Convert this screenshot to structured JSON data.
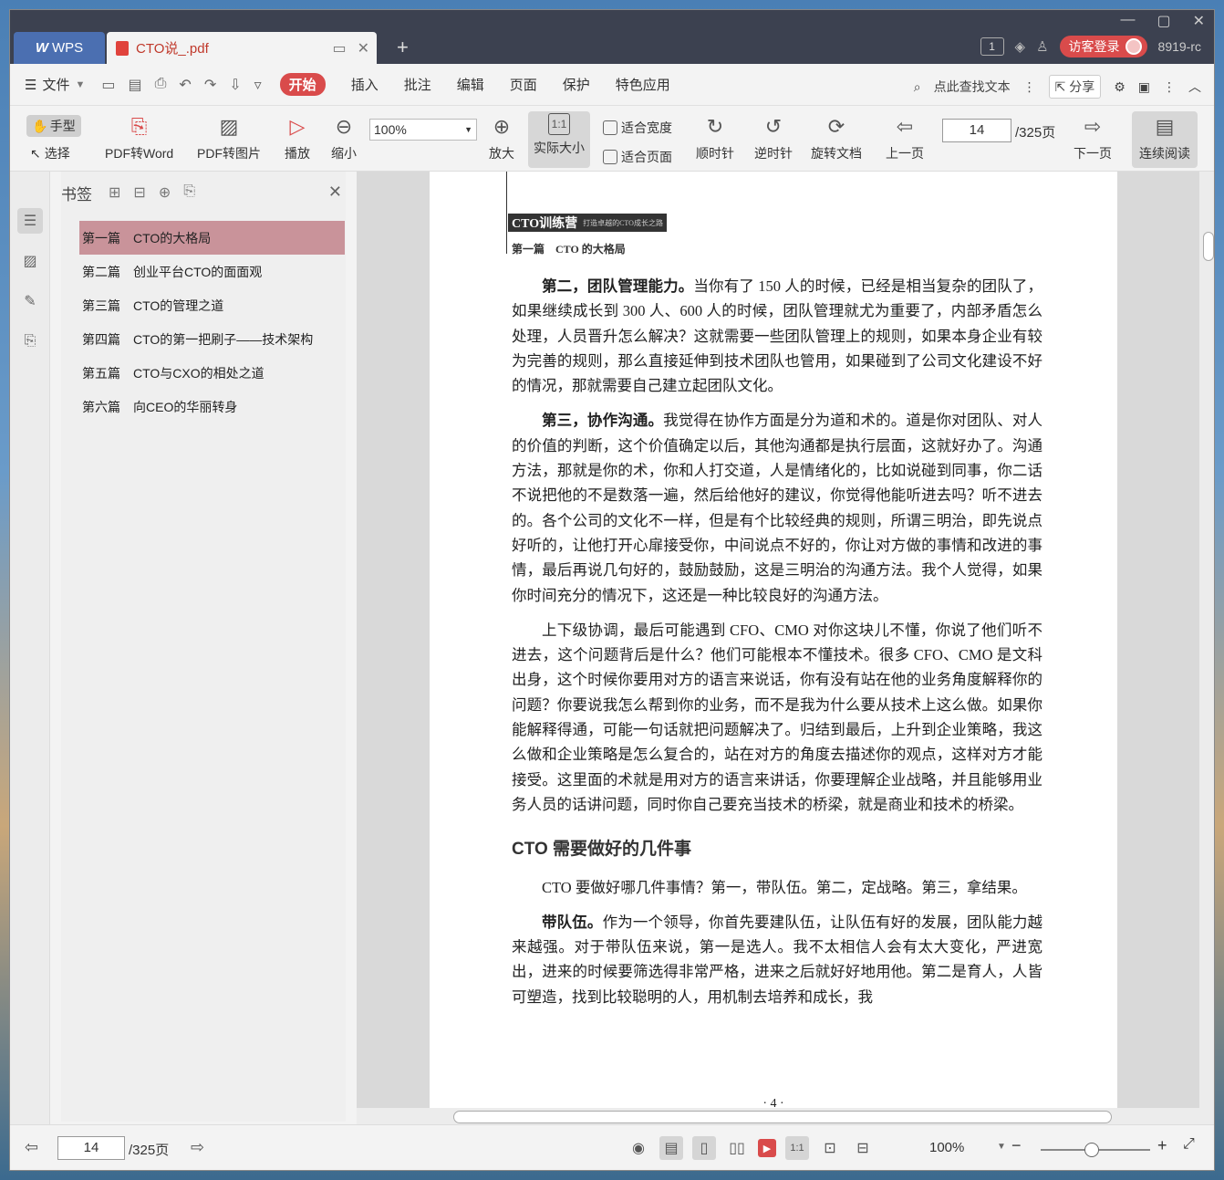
{
  "titlebar": {
    "app_tab": "WPS",
    "doc_tab": "CTO说_.pdf",
    "page_badge": "1",
    "visitor_login": "访客登录",
    "version": "8919-rc"
  },
  "menubar": {
    "file": "文件",
    "items": [
      "开始",
      "插入",
      "批注",
      "编辑",
      "页面",
      "保护",
      "特色应用"
    ],
    "active": "开始",
    "search": "点此查找文本",
    "share": "分享"
  },
  "toolbar": {
    "hand": "手型",
    "select": "选择",
    "pdf_to_word": "PDF转Word",
    "pdf_to_image": "PDF转图片",
    "play": "播放",
    "zoom_out": "缩小",
    "zoom_value": "100%",
    "zoom_in": "放大",
    "actual_size": "实际大小",
    "fit_width": "适合宽度",
    "fit_page": "适合页面",
    "clockwise": "顺时针",
    "counterclockwise": "逆时针",
    "rotate_doc": "旋转文档",
    "prev_page": "上一页",
    "page_value": "14",
    "page_total": "/325页",
    "next_page": "下一页",
    "continuous": "连续阅读"
  },
  "bookmarks": {
    "title": "书签",
    "items": [
      {
        "num": "第一篇",
        "label": "CTO的大格局"
      },
      {
        "num": "第二篇",
        "label": "创业平台CTO的面面观"
      },
      {
        "num": "第三篇",
        "label": "CTO的管理之道"
      },
      {
        "num": "第四篇",
        "label": "CTO的第一把刷子——技术架构"
      },
      {
        "num": "第五篇",
        "label": "CTO与CXO的相处之道"
      },
      {
        "num": "第六篇",
        "label": "向CEO的华丽转身"
      }
    ]
  },
  "page": {
    "banner": "CTO训练营",
    "banner_sub": "打造卓越的CTO成长之路",
    "chapter": "第一篇　CTO 的大格局",
    "p1_bold": "第二，团队管理能力。",
    "p1": "当你有了 150 人的时候，已经是相当复杂的团队了，如果继续成长到 300 人、600 人的时候，团队管理就尤为重要了，内部矛盾怎么处理，人员晋升怎么解决？这就需要一些团队管理上的规则，如果本身企业有较为完善的规则，那么直接延伸到技术团队也管用，如果碰到了公司文化建设不好的情况，那就需要自己建立起团队文化。",
    "p2_bold": "第三，协作沟通。",
    "p2": "我觉得在协作方面是分为道和术的。道是你对团队、对人的价值的判断，这个价值确定以后，其他沟通都是执行层面，这就好办了。沟通方法，那就是你的术，你和人打交道，人是情绪化的，比如说碰到同事，你二话不说把他的不是数落一遍，然后给他好的建议，你觉得他能听进去吗？听不进去的。各个公司的文化不一样，但是有个比较经典的规则，所谓三明治，即先说点好听的，让他打开心扉接受你，中间说点不好的，你让对方做的事情和改进的事情，最后再说几句好的，鼓励鼓励，这是三明治的沟通方法。我个人觉得，如果你时间充分的情况下，这还是一种比较良好的沟通方法。",
    "p3": "上下级协调，最后可能遇到 CFO、CMO 对你这块儿不懂，你说了他们听不进去，这个问题背后是什么？他们可能根本不懂技术。很多 CFO、CMO 是文科出身，这个时候你要用对方的语言来说话，你有没有站在他的业务角度解释你的问题？你要说我怎么帮到你的业务，而不是我为什么要从技术上这么做。如果你能解释得通，可能一句话就把问题解决了。归结到最后，上升到企业策略，我这么做和企业策略是怎么复合的，站在对方的角度去描述你的观点，这样对方才能接受。这里面的术就是用对方的语言来讲话，你要理解企业战略，并且能够用业务人员的话讲问题，同时你自己要充当技术的桥梁，就是商业和技术的桥梁。",
    "section": "CTO 需要做好的几件事",
    "p4": "CTO 要做好哪几件事情？第一，带队伍。第二，定战略。第三，拿结果。",
    "p5_bold": "带队伍。",
    "p5": "作为一个领导，你首先要建队伍，让队伍有好的发展，团队能力越来越强。对于带队伍来说，第一是选人。我不太相信人会有太大变化，严进宽出，进来的时候要筛选得非常严格，进来之后就好好地用他。第二是育人，人皆可塑造，找到比较聪明的人，用机制去培养和成长，我",
    "folio": "· 4 ·"
  },
  "statusbar": {
    "page_value": "14",
    "page_total": "/325页",
    "zoom": "100%"
  }
}
